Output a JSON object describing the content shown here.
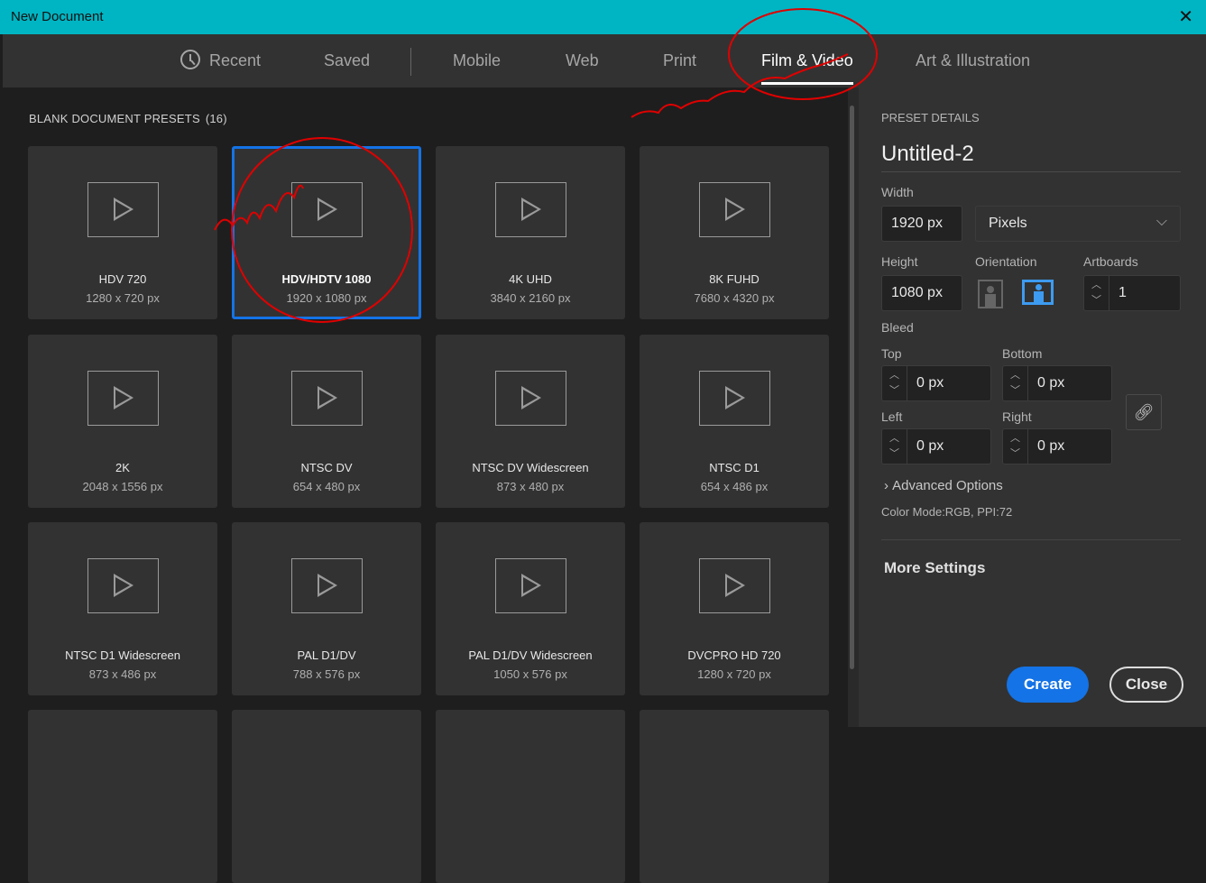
{
  "window": {
    "title": "New Document",
    "close": "✕"
  },
  "tabs": [
    {
      "label": "Recent"
    },
    {
      "label": "Saved"
    },
    {
      "label": "Mobile"
    },
    {
      "label": "Web"
    },
    {
      "label": "Print"
    },
    {
      "label": "Film & Video",
      "active": true
    },
    {
      "label": "Art & Illustration"
    }
  ],
  "presets": {
    "title": "BLANK DOCUMENT PRESETS",
    "count": "(16)",
    "items": [
      {
        "name": "HDV 720",
        "size": "1280 x 720 px"
      },
      {
        "name": "HDV/HDTV 1080",
        "size": "1920 x 1080 px",
        "selected": true
      },
      {
        "name": "4K UHD",
        "size": "3840 x 2160 px"
      },
      {
        "name": "8K FUHD",
        "size": "7680 x 4320 px"
      },
      {
        "name": "2K",
        "size": "2048 x 1556 px"
      },
      {
        "name": "NTSC DV",
        "size": "654 x 480 px"
      },
      {
        "name": "NTSC DV Widescreen",
        "size": "873 x 480 px"
      },
      {
        "name": "NTSC D1",
        "size": "654 x 486 px"
      },
      {
        "name": "NTSC D1 Widescreen",
        "size": "873 x 486 px"
      },
      {
        "name": "PAL D1/DV",
        "size": "788 x 576 px"
      },
      {
        "name": "PAL D1/DV Widescreen",
        "size": "1050 x 576 px"
      },
      {
        "name": "DVCPRO HD 720",
        "size": "1280 x 720 px"
      }
    ]
  },
  "details": {
    "heading": "PRESET DETAILS",
    "doc_name": "Untitled-2",
    "width_label": "Width",
    "width": "1920 px",
    "units": "Pixels",
    "height_label": "Height",
    "height": "1080 px",
    "orientation_label": "Orientation",
    "artboards_label": "Artboards",
    "artboards": "1",
    "bleed_label": "Bleed",
    "top_label": "Top",
    "top": "0 px",
    "bottom_label": "Bottom",
    "bottom": "0 px",
    "left_label": "Left",
    "left": "0 px",
    "right_label": "Right",
    "right": "0 px",
    "advanced": "Advanced Options",
    "color_mode": "Color Mode:RGB, PPI:72",
    "more": "More Settings",
    "create": "Create",
    "close": "Close"
  },
  "colors": {
    "accent": "#1473e6",
    "titlebar": "#00b5c3",
    "annotation": "#e00000"
  }
}
